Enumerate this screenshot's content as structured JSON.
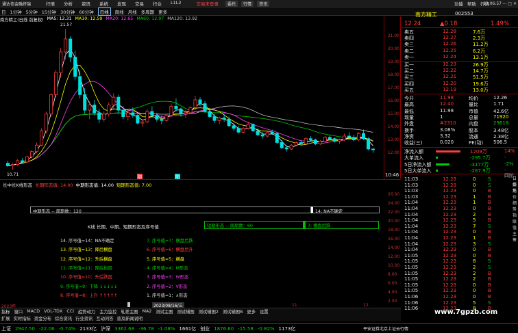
{
  "titlebar": {
    "app": "通达信金融终端",
    "menu": [
      "行情",
      "分析",
      "资讯",
      "系统",
      "发现",
      "交易",
      "行业",
      "L1L2"
    ],
    "alert": "交易未登录",
    "right_buttons": [
      "委托",
      "行情",
      "资讯"
    ],
    "right_menu": [
      "功能",
      "帮助",
      "行情"
    ],
    "time": "11:06:57"
  },
  "toolbar": {
    "items": [
      "日",
      "1分钟",
      "5分钟",
      "15分钟",
      "30分钟",
      "60分钟",
      "日线",
      "周线",
      "月线",
      "多周期",
      "更多"
    ],
    "selected": "日线"
  },
  "ma_legend": {
    "title": "南方精工(日线 前复权)",
    "items": [
      {
        "label": "MA5: 12.31",
        "color": "#ffffff"
      },
      {
        "label": "MA10: 12.59",
        "color": "#ffff00"
      },
      {
        "label": "MA20: 12.65",
        "color": "#ff40ff"
      },
      {
        "label": "MA60: 12.97",
        "color": "#00d000"
      },
      {
        "label": "MA120: 13.92",
        "color": "#c0c0c0"
      }
    ]
  },
  "price_axis": {
    "ticks": [
      "21.00",
      "20.00",
      "19.00",
      "18.00",
      "17.00",
      "16.00",
      "15.00",
      "14.00",
      "13.00",
      "12.00"
    ]
  },
  "annotations": {
    "high": "21.57",
    "low": "10.71"
  },
  "main_markers": [
    {
      "text": "阴",
      "color": "#ff4040"
    },
    {
      "text": "阳",
      "color": "#00d0d0"
    }
  ],
  "chart_data": {
    "type": "candlestick",
    "ohlc": [
      [
        11.2,
        11.4,
        10.9,
        11.0
      ],
      [
        11.0,
        11.2,
        10.71,
        11.1
      ],
      [
        11.1,
        11.5,
        11.0,
        11.4
      ],
      [
        11.4,
        11.6,
        11.2,
        11.3
      ],
      [
        11.3,
        11.8,
        11.2,
        11.7
      ],
      [
        11.7,
        12.2,
        11.6,
        12.1
      ],
      [
        12.1,
        12.8,
        12.0,
        12.6
      ],
      [
        12.6,
        13.9,
        12.5,
        13.7
      ],
      [
        13.7,
        15.2,
        13.5,
        15.0
      ],
      [
        15.0,
        16.6,
        14.8,
        16.5
      ],
      [
        16.5,
        18.4,
        16.3,
        18.2
      ],
      [
        18.2,
        20.1,
        17.8,
        19.8
      ],
      [
        19.8,
        21.57,
        19.2,
        20.8
      ],
      [
        20.8,
        21.0,
        19.0,
        19.4
      ],
      [
        19.4,
        19.9,
        17.6,
        17.9
      ],
      [
        17.9,
        18.4,
        16.2,
        16.5
      ],
      [
        16.5,
        17.0,
        15.0,
        15.3
      ],
      [
        15.3,
        16.0,
        14.6,
        15.7
      ],
      [
        15.7,
        16.1,
        14.9,
        15.1
      ],
      [
        15.1,
        15.4,
        14.3,
        14.6
      ],
      [
        14.6,
        15.2,
        14.4,
        15.0
      ],
      [
        15.0,
        15.9,
        14.8,
        15.7
      ],
      [
        15.7,
        16.6,
        15.4,
        16.3
      ],
      [
        16.3,
        16.5,
        15.1,
        15.3
      ],
      [
        15.3,
        15.6,
        14.6,
        14.8
      ],
      [
        14.8,
        15.3,
        14.5,
        15.1
      ],
      [
        15.1,
        15.5,
        14.7,
        14.9
      ],
      [
        14.9,
        15.0,
        14.2,
        14.3
      ],
      [
        14.3,
        14.6,
        14.0,
        14.4
      ],
      [
        14.4,
        15.4,
        14.3,
        15.2
      ],
      [
        15.2,
        15.6,
        14.7,
        14.9
      ],
      [
        14.9,
        15.1,
        14.4,
        14.6
      ],
      [
        14.6,
        14.9,
        14.2,
        14.5
      ],
      [
        14.5,
        15.0,
        14.4,
        14.9
      ],
      [
        14.9,
        15.8,
        14.8,
        15.6
      ],
      [
        15.6,
        16.2,
        15.2,
        15.4
      ],
      [
        15.4,
        15.5,
        14.8,
        15.0
      ],
      [
        15.0,
        15.3,
        14.7,
        15.1
      ],
      [
        15.1,
        15.6,
        15.0,
        15.5
      ],
      [
        15.5,
        16.4,
        15.3,
        16.1
      ],
      [
        16.1,
        16.3,
        15.6,
        15.8
      ],
      [
        15.8,
        16.0,
        15.1,
        15.2
      ],
      [
        15.2,
        15.4,
        14.7,
        14.8
      ],
      [
        14.8,
        15.0,
        14.3,
        14.5
      ],
      [
        14.5,
        14.8,
        14.2,
        14.7
      ],
      [
        14.7,
        15.0,
        14.4,
        14.6
      ],
      [
        14.6,
        14.8,
        14.0,
        14.1
      ],
      [
        14.1,
        14.3,
        13.7,
        13.9
      ],
      [
        13.9,
        14.1,
        13.5,
        13.6
      ],
      [
        13.6,
        14.0,
        13.5,
        13.9
      ],
      [
        13.9,
        14.4,
        13.8,
        14.2
      ],
      [
        14.2,
        14.3,
        13.6,
        13.7
      ],
      [
        13.7,
        13.9,
        13.3,
        13.4
      ],
      [
        13.4,
        13.6,
        13.1,
        13.3
      ],
      [
        13.3,
        13.7,
        13.2,
        13.6
      ],
      [
        13.6,
        13.8,
        13.4,
        13.5
      ],
      [
        13.5,
        13.6,
        12.7,
        12.8
      ],
      [
        12.8,
        13.0,
        12.3,
        12.4
      ],
      [
        12.4,
        12.6,
        12.1,
        12.3
      ],
      [
        12.3,
        12.7,
        12.2,
        12.6
      ],
      [
        12.6,
        12.9,
        12.5,
        12.8
      ],
      [
        12.8,
        13.0,
        12.6,
        12.7
      ],
      [
        12.7,
        13.2,
        12.6,
        13.1
      ],
      [
        13.1,
        13.3,
        12.9,
        13.0
      ],
      [
        13.0,
        13.1,
        12.6,
        12.7
      ],
      [
        12.7,
        13.0,
        12.6,
        12.9
      ],
      [
        12.9,
        13.3,
        12.8,
        13.2
      ],
      [
        13.2,
        13.4,
        13.0,
        13.1
      ],
      [
        13.1,
        13.2,
        12.8,
        12.9
      ],
      [
        12.9,
        13.1,
        12.7,
        13.0
      ],
      [
        13.0,
        13.5,
        12.9,
        13.3
      ],
      [
        13.3,
        13.6,
        13.1,
        13.2
      ],
      [
        13.2,
        13.4,
        12.9,
        13.0
      ],
      [
        13.0,
        13.6,
        12.9,
        13.5
      ],
      [
        13.5,
        13.8,
        13.0,
        13.1
      ],
      [
        13.1,
        13.2,
        12.2,
        12.3
      ],
      [
        12.3,
        12.4,
        12.0,
        12.24
      ]
    ],
    "ma_colors": {
      "ma5": "#ffffff",
      "ma10": "#ffff00",
      "ma20": "#ff40ff",
      "ma60": "#00d000",
      "ma120": "#c0c0c0"
    },
    "ylim": [
      10.5,
      21.8
    ]
  },
  "sub_legend": {
    "title": "长中长K线形态",
    "items": [
      {
        "label": "长期形态值: 14.00",
        "color": "#ff4040"
      },
      {
        "label": "中期形态值: 14.00",
        "color": "#ffffff"
      },
      {
        "label": "短期形态值: 7.00",
        "color": "#ffff00"
      }
    ]
  },
  "sub_axis": {
    "ticks": [
      "26.00",
      "24.00",
      "22.00",
      "20.00",
      "18.00",
      "16.00",
      "14.00",
      "12.00",
      "10.00",
      "8.00",
      "6.00",
      "4.00",
      "2.00"
    ]
  },
  "sub_boxes": {
    "mid_cycle": "中期形态 -- 周期数：120",
    "mid_right": "14: NA不确定",
    "short_cycle": "短期形态 -- 周期数：60",
    "short_right": "7: 横盘后跌",
    "header": "K线 长期、中期、短期形态及序号值"
  },
  "seq_left": [
    {
      "t": "14. 序号值=14：NA不确定",
      "c": "#e0e0e0"
    },
    {
      "t": "13. 序号值=13：降后横盘",
      "c": "#ffff00"
    },
    {
      "t": "12. 序号值=12：升后横盘",
      "c": "#ffff00"
    },
    {
      "t": "11. 序号值=11：降后抬回",
      "c": "#00d000"
    },
    {
      "t": "10. 序号值=10：升后跌回",
      "c": "#ff4040"
    },
    {
      "t": "9. 序号值=9：下降 ↓↓↓↓↓",
      "c": "#00d000"
    },
    {
      "t": "8. 序号值=8：上升 ↑↑↑↑↑",
      "c": "#ff4040"
    }
  ],
  "seq_right": [
    {
      "t": "7. 序号值=7：横盘后跌",
      "c": "#00d000"
    },
    {
      "t": "6. 序号值=6：横盘后升",
      "c": "#ff4040"
    },
    {
      "t": "5. 序号值=5：横盘",
      "c": "#ffff00"
    },
    {
      "t": "4. 序号值=4：M形态",
      "c": "#00d000"
    },
    {
      "t": "3. 序号值=3：W形态",
      "c": "#ff40ff"
    },
    {
      "t": "2. 序号值=2：V形态",
      "c": "#ff40ff"
    },
    {
      "t": "1. 序号值=1：∧形态",
      "c": "#e0e0e0"
    }
  ],
  "sub_xaxis": {
    "left": "2023年",
    "mid": "2023/08/16/三",
    "mid2": "11",
    "right": "12"
  },
  "bottom_tabs": [
    "指标",
    "窗口",
    "MACD",
    "VOL-TDX",
    "CCI",
    "趋势动力",
    "主力监控",
    "轧差主图",
    "MA2",
    "测试主图",
    "测试辅图",
    "测试辅图2",
    "测试辅图B",
    "更多",
    "设置"
  ],
  "bottom_tabs2": [
    "扩展",
    "实时指标",
    "资金分布",
    "综合资讯",
    "行业资讯",
    "互动问答",
    "普及新闻说明"
  ],
  "stock": {
    "name": "南方精工",
    "code": "002553",
    "price": "12.24",
    "change": "▲0.18",
    "pct": "1.49%"
  },
  "order_book": {
    "sell": [
      [
        "卖五",
        "12.28",
        "7.6万"
      ],
      [
        "卖四",
        "12.27",
        "2.3万"
      ],
      [
        "卖三",
        "12.26",
        "11.2万"
      ],
      [
        "卖二",
        "12.25",
        "6.2万"
      ],
      [
        "卖一",
        "12.24",
        "13.1万"
      ]
    ],
    "buy": [
      [
        "买一",
        "12.23",
        "26.9万"
      ],
      [
        "买二",
        "12.22",
        "14.7万"
      ],
      [
        "买三",
        "12.21",
        "51.5万"
      ],
      [
        "买四",
        "12.20",
        "19.6万"
      ],
      [
        "买五",
        "12.19",
        "13.0万"
      ]
    ]
  },
  "quote": [
    [
      "今开",
      "11.98",
      "均价",
      "12.26"
    ],
    [
      "最高",
      "12.40",
      "量比",
      "1.71"
    ],
    [
      "最低",
      "11.98",
      "市值",
      "42.6亿"
    ],
    [
      "现量",
      "1",
      "总量",
      "71920"
    ],
    [
      "外盘",
      "#2310",
      "内盘",
      "29618"
    ],
    [
      "换手",
      "3.08%",
      "股本",
      "3.48亿"
    ],
    [
      "净资",
      "3.32",
      "流通",
      "2.38亿"
    ],
    [
      "收益(三)",
      "0.020",
      "PE(动)",
      "506.5"
    ]
  ],
  "money_flow": [
    {
      "label": "净流入额",
      "value": "1209万",
      "pct": "14%",
      "c": "#ff3c3c"
    },
    {
      "label": "大单流入",
      "value": "-295.7万",
      "pct": "-",
      "c": "#00d000"
    },
    {
      "label": "5日净流入额",
      "value": "-3177万",
      "pct": "-2%",
      "c": "#00d000"
    },
    {
      "label": "5日大单流入",
      "value": "-267.9万",
      "pct": "-",
      "c": "#00d000"
    }
  ],
  "ticks": [
    [
      "11:03",
      "12.23",
      "0",
      "S"
    ],
    [
      "11:03",
      "12.23",
      "0",
      "S"
    ],
    [
      "11:03",
      "12.23",
      "0",
      "B"
    ],
    [
      "11:03",
      "12.23",
      "1",
      "B"
    ],
    [
      "11:04",
      "12.23",
      "1",
      "B"
    ],
    [
      "11:04",
      "12.23",
      "0",
      "B"
    ],
    [
      "11:04",
      "12.23",
      "2",
      "B"
    ],
    [
      "11:04",
      "12.23",
      "5",
      "B"
    ],
    [
      "11:04",
      "12.23",
      "7",
      "S"
    ],
    [
      "11:04",
      "12.23",
      "0",
      "B"
    ],
    [
      "11:04",
      "12.23",
      "1",
      "B"
    ],
    [
      "11:04",
      "12.23",
      "3",
      "S"
    ],
    [
      "11:04",
      "12.23",
      "0",
      "B"
    ],
    [
      "11:05",
      "12.23",
      "0",
      "B"
    ],
    [
      "11:05",
      "12.23",
      "8",
      "S"
    ],
    [
      "11:05",
      "12.23",
      "2",
      "S"
    ],
    [
      "11:05",
      "12.23",
      "2",
      "B"
    ],
    [
      "11:05",
      "12.23",
      "2",
      "B"
    ],
    [
      "11:05",
      "12.23",
      "0",
      "B"
    ],
    [
      "11:05",
      "12.23",
      "0",
      "B"
    ],
    [
      "11:06",
      "12.23",
      "0",
      "B"
    ],
    [
      "11:06",
      "12.23",
      "5",
      "S"
    ],
    [
      "11:06",
      "12.23",
      "8",
      "B"
    ]
  ],
  "tick_top": {
    "time": "10:46",
    "tag": "四阶"
  },
  "right_tabs": [
    "日线",
    "委托",
    "笔",
    "价",
    "细",
    "势",
    "指",
    "联",
    "值",
    "主",
    "筹"
  ],
  "status": {
    "sh_label": "上证",
    "sh": "2947.50",
    "sh_ch": "-22.06",
    "sh_pct": "-0.74%",
    "sh_amt": "2133亿",
    "sz_label": "沪深",
    "sz": "3362.68",
    "sz_ch": "-36.78",
    "sz_pct": "-1.08%",
    "sz_amt": "1661亿",
    "cy_label": "创业",
    "cy": "1876.60",
    "cy_ch": "-15.58",
    "cy_pct": "-0.82%",
    "cy_amt": "1173亿",
    "right": "平安证券北京上证云行情"
  },
  "watermark": "www.7gpzb.com"
}
